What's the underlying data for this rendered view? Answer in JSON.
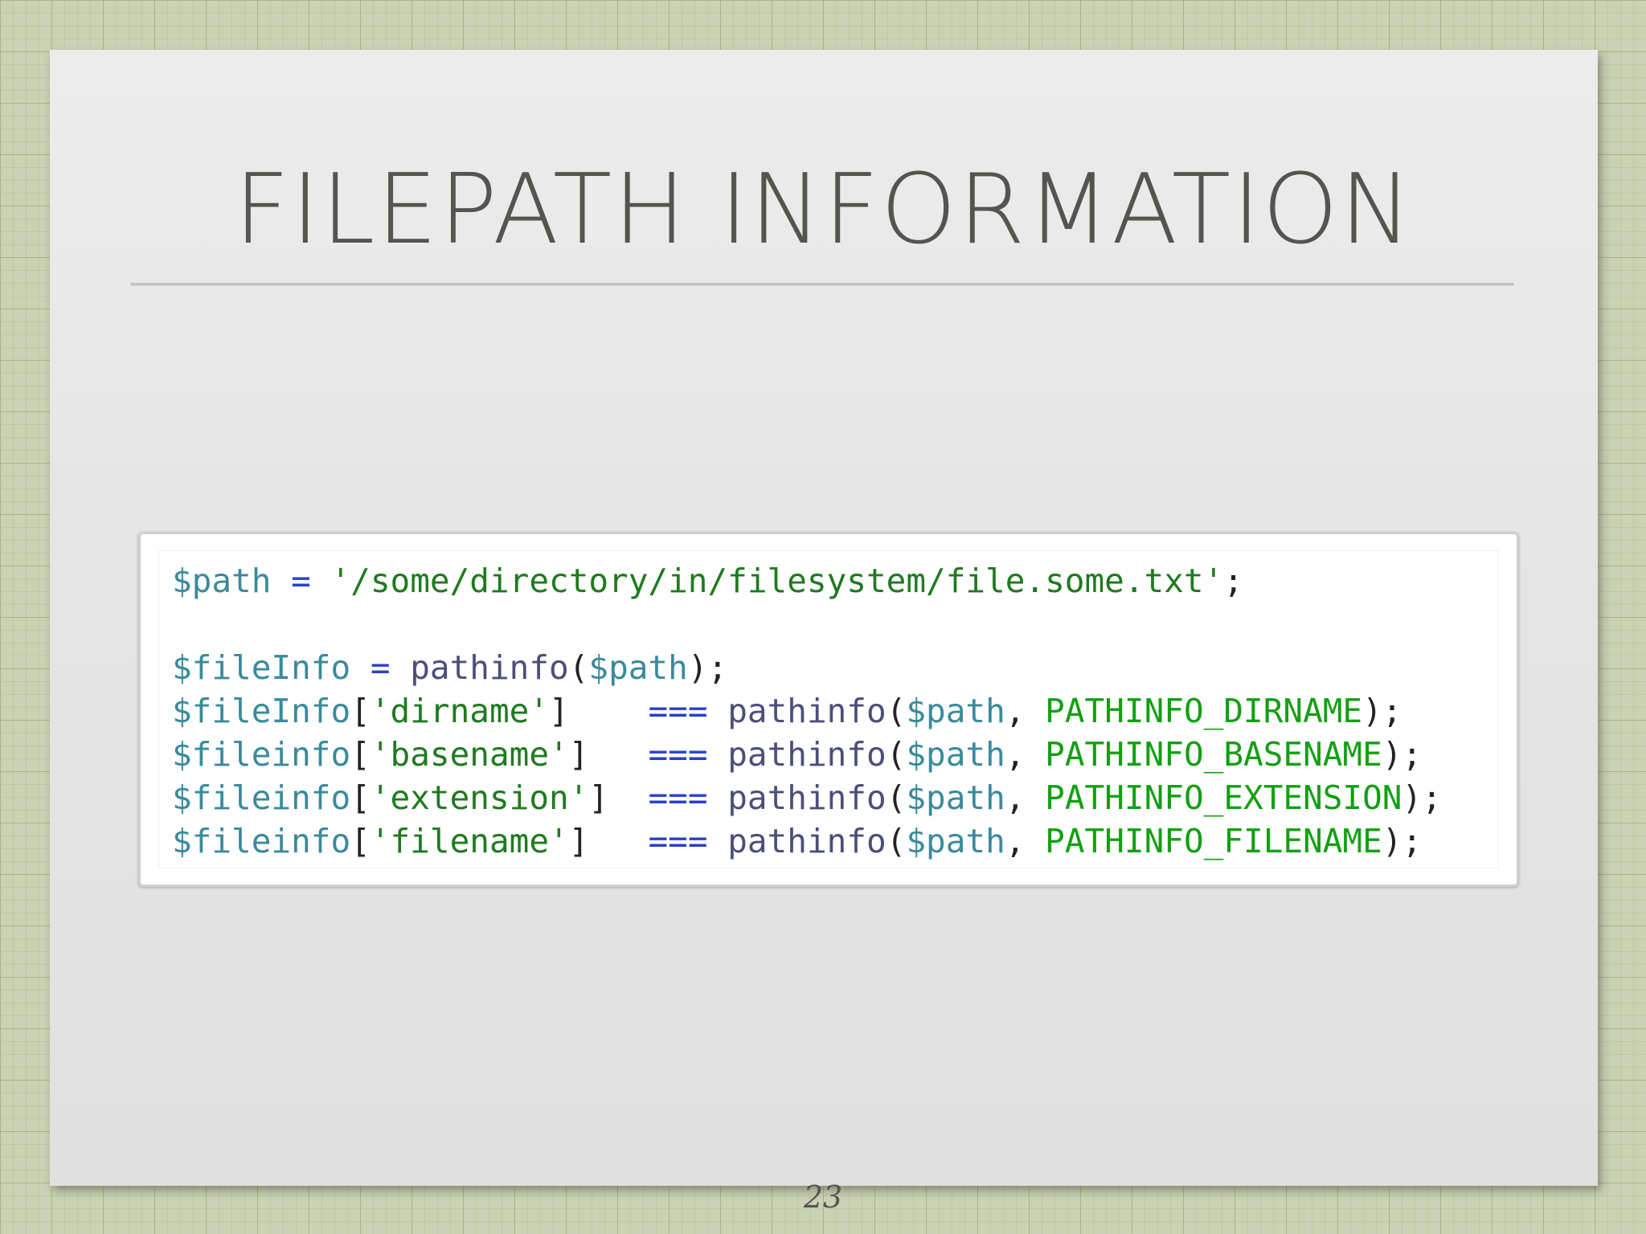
{
  "slide": {
    "title": "FILEPATH INFORMATION",
    "page_number": "23"
  },
  "code": {
    "lines": [
      [
        {
          "text": "$path",
          "kind": "variable"
        },
        {
          "text": " ",
          "kind": "plain"
        },
        {
          "text": "=",
          "kind": "operator"
        },
        {
          "text": " ",
          "kind": "plain"
        },
        {
          "text": "'/some/directory/in/filesystem/file.some.txt'",
          "kind": "string"
        },
        {
          "text": ";",
          "kind": "plain"
        }
      ],
      [],
      [
        {
          "text": "$fileInfo",
          "kind": "variable"
        },
        {
          "text": " ",
          "kind": "plain"
        },
        {
          "text": "=",
          "kind": "operator"
        },
        {
          "text": " ",
          "kind": "plain"
        },
        {
          "text": "pathinfo",
          "kind": "function"
        },
        {
          "text": "(",
          "kind": "plain"
        },
        {
          "text": "$path",
          "kind": "variable"
        },
        {
          "text": ");",
          "kind": "plain"
        }
      ],
      [
        {
          "text": "$fileInfo",
          "kind": "variable"
        },
        {
          "text": "[",
          "kind": "plain"
        },
        {
          "text": "'dirname'",
          "kind": "string"
        },
        {
          "text": "]    ",
          "kind": "plain"
        },
        {
          "text": "===",
          "kind": "operator"
        },
        {
          "text": " ",
          "kind": "plain"
        },
        {
          "text": "pathinfo",
          "kind": "function"
        },
        {
          "text": "(",
          "kind": "plain"
        },
        {
          "text": "$path",
          "kind": "variable"
        },
        {
          "text": ", ",
          "kind": "plain"
        },
        {
          "text": "PATHINFO_DIRNAME",
          "kind": "constant"
        },
        {
          "text": ");",
          "kind": "plain"
        }
      ],
      [
        {
          "text": "$fileinfo",
          "kind": "variable"
        },
        {
          "text": "[",
          "kind": "plain"
        },
        {
          "text": "'basename'",
          "kind": "string"
        },
        {
          "text": "]   ",
          "kind": "plain"
        },
        {
          "text": "===",
          "kind": "operator"
        },
        {
          "text": " ",
          "kind": "plain"
        },
        {
          "text": "pathinfo",
          "kind": "function"
        },
        {
          "text": "(",
          "kind": "plain"
        },
        {
          "text": "$path",
          "kind": "variable"
        },
        {
          "text": ", ",
          "kind": "plain"
        },
        {
          "text": "PATHINFO_BASENAME",
          "kind": "constant"
        },
        {
          "text": ");",
          "kind": "plain"
        }
      ],
      [
        {
          "text": "$fileinfo",
          "kind": "variable"
        },
        {
          "text": "[",
          "kind": "plain"
        },
        {
          "text": "'extension'",
          "kind": "string"
        },
        {
          "text": "]  ",
          "kind": "plain"
        },
        {
          "text": "===",
          "kind": "operator"
        },
        {
          "text": " ",
          "kind": "plain"
        },
        {
          "text": "pathinfo",
          "kind": "function"
        },
        {
          "text": "(",
          "kind": "plain"
        },
        {
          "text": "$path",
          "kind": "variable"
        },
        {
          "text": ", ",
          "kind": "plain"
        },
        {
          "text": "PATHINFO_EXTENSION",
          "kind": "constant"
        },
        {
          "text": ");",
          "kind": "plain"
        }
      ],
      [
        {
          "text": "$fileinfo",
          "kind": "variable"
        },
        {
          "text": "[",
          "kind": "plain"
        },
        {
          "text": "'filename'",
          "kind": "string"
        },
        {
          "text": "]   ",
          "kind": "plain"
        },
        {
          "text": "===",
          "kind": "operator"
        },
        {
          "text": " ",
          "kind": "plain"
        },
        {
          "text": "pathinfo",
          "kind": "function"
        },
        {
          "text": "(",
          "kind": "plain"
        },
        {
          "text": "$path",
          "kind": "variable"
        },
        {
          "text": ", ",
          "kind": "plain"
        },
        {
          "text": "PATHINFO_FILENAME",
          "kind": "constant"
        },
        {
          "text": ");",
          "kind": "plain"
        }
      ]
    ]
  },
  "colors": {
    "variable": "#3a8a9c",
    "operator": "#2a3fd0",
    "string": "#1f7a1f",
    "function": "#4a4f7a",
    "constant": "#12a012",
    "plain": "#222222"
  }
}
